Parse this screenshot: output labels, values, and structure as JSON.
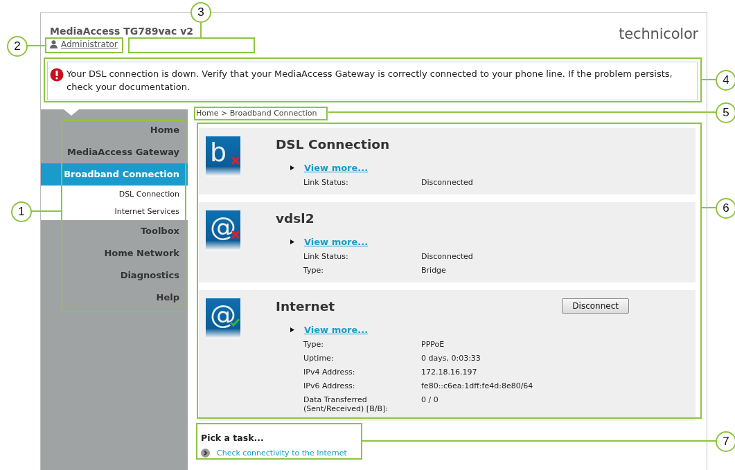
{
  "header": {
    "title": "MediaAccess TG789vac v2",
    "logo": "technicolor",
    "user_link": "Administrator"
  },
  "alert": {
    "error": true,
    "message": "Your DSL connection is down. Verify that your MediaAccess Gateway is correctly connected to your phone line. If the problem persists, check your documentation."
  },
  "sidebar": {
    "items": [
      {
        "label": "Home",
        "selected": false
      },
      {
        "label": "MediaAccess Gateway",
        "selected": false
      },
      {
        "label": "Broadband Connection",
        "selected": true,
        "children": [
          {
            "label": "DSL Connection",
            "selected": false
          },
          {
            "label": "Internet Services",
            "selected": false
          }
        ]
      },
      {
        "label": "Toolbox",
        "selected": false
      },
      {
        "label": "Home Network",
        "selected": false
      },
      {
        "label": "Diagnostics",
        "selected": false
      },
      {
        "label": "Help",
        "selected": false
      }
    ]
  },
  "breadcrumb": "Home > Broadband Connection",
  "sections": [
    {
      "icon_glyph": "b",
      "connected": false,
      "title": "DSL Connection",
      "link": "View more...",
      "rows": [
        {
          "label": "Link Status:",
          "value": "Disconnected"
        }
      ]
    },
    {
      "icon_glyph": "@",
      "connected": false,
      "title": "vdsl2",
      "link": "View more...",
      "rows": [
        {
          "label": "Link Status:",
          "value": "Disconnected"
        },
        {
          "label": "Type:",
          "value": "Bridge"
        }
      ]
    },
    {
      "icon_glyph": "@",
      "connected": true,
      "title": "Internet",
      "button": "Disconnect",
      "link": "View more...",
      "rows": [
        {
          "label": "Type:",
          "value": "PPPoE"
        },
        {
          "label": "Uptime:",
          "value": "0 days, 0:03:33"
        },
        {
          "label": "IPv4 Address:",
          "value": "172.18.16.197"
        },
        {
          "label": "IPv6 Address:",
          "value": "fe80::c6ea:1dff:fe4d:8e80/64"
        },
        {
          "label": "Data Transferred (Sent/Received) [B/B]:",
          "value": "0 / 0"
        }
      ]
    }
  ],
  "tasks": {
    "title": "Pick a task...",
    "items": [
      "Check connectivity to the Internet"
    ]
  },
  "callouts": [
    {
      "number": "1"
    },
    {
      "number": "2"
    },
    {
      "number": "3"
    },
    {
      "number": "4"
    },
    {
      "number": "5"
    },
    {
      "number": "6"
    },
    {
      "number": "7"
    }
  ]
}
